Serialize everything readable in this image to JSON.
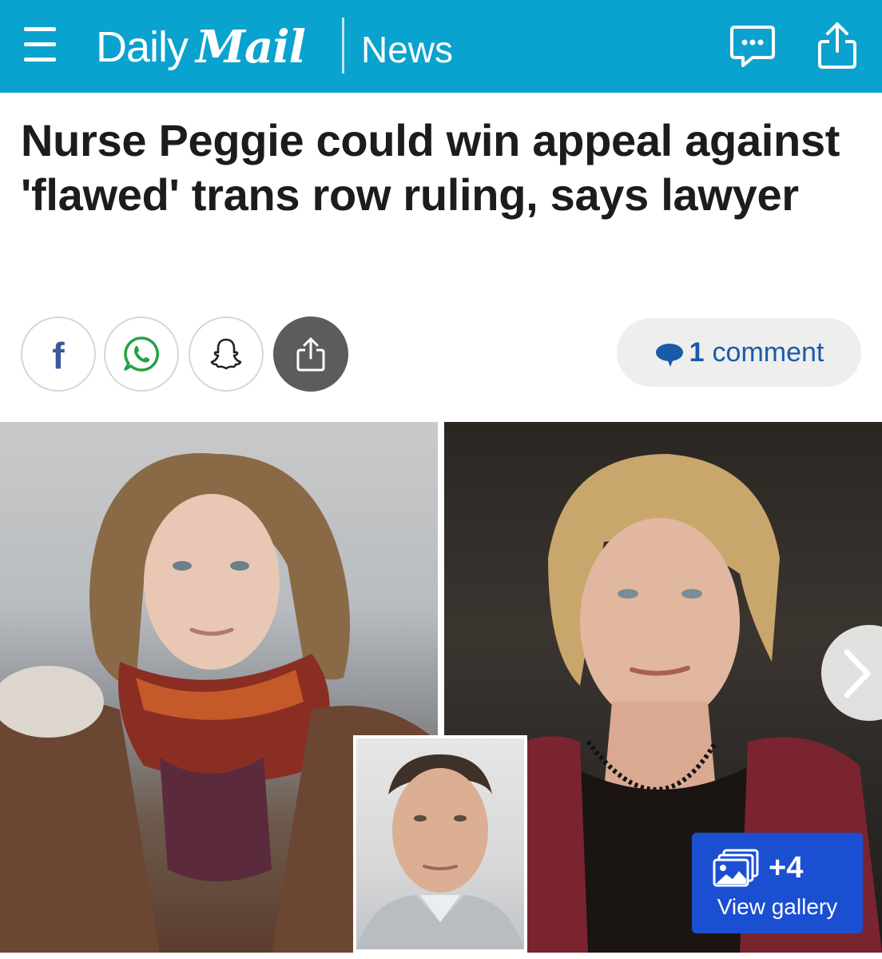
{
  "header": {
    "logo_daily": "Daily",
    "logo_mail": "Mail",
    "section": "News",
    "background_color": "#0aa2cf",
    "icons": [
      "menu-icon",
      "comments-icon",
      "share-icon"
    ]
  },
  "article": {
    "headline": "Nurse Peggie could win appeal against 'flawed' trans row ruling, says lawyer"
  },
  "share_bar": {
    "buttons": [
      "facebook-icon",
      "whatsapp-icon",
      "snapchat-icon",
      "share-icon"
    ],
    "facebook_letter": "f",
    "comments": {
      "count": "1",
      "label": "comment",
      "color": "#1a5aa8"
    }
  },
  "gallery": {
    "extra_count": "+4",
    "label": "View gallery",
    "button_color": "#1a4fd1"
  }
}
